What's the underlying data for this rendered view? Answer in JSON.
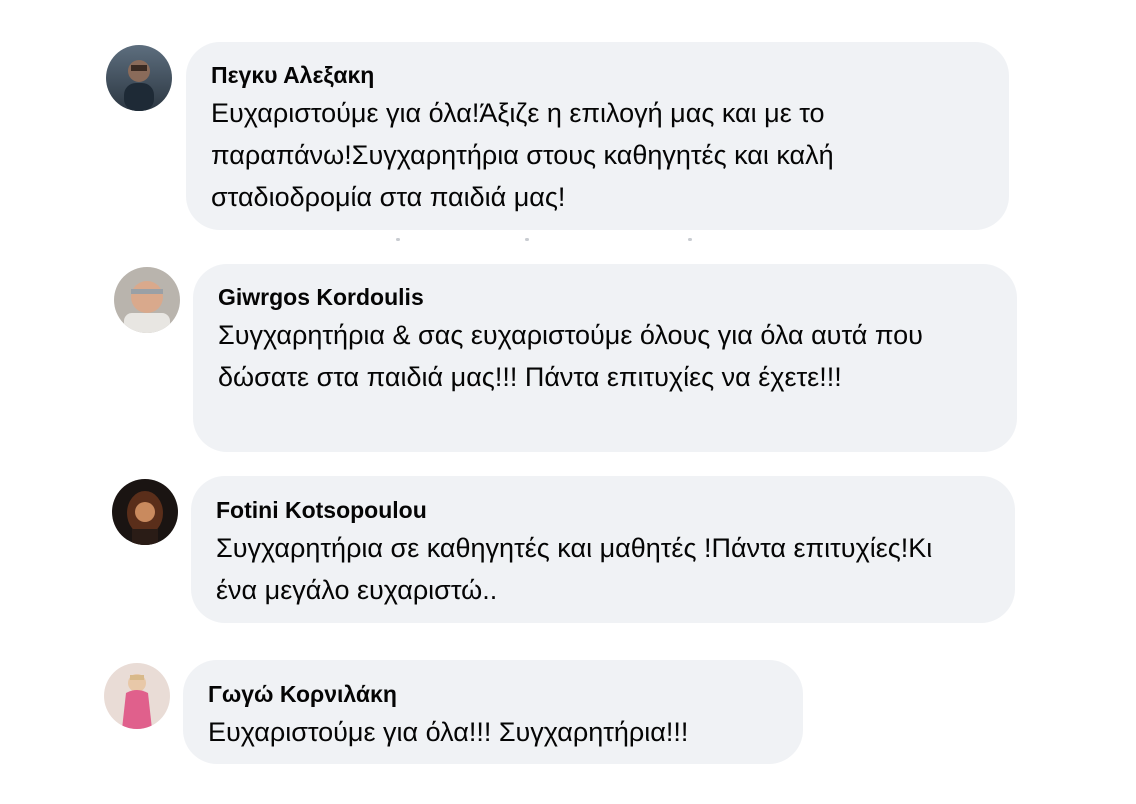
{
  "comments": [
    {
      "author": "Πεγκυ Αλεξακη",
      "text": "Ευχαριστούμε για όλα!Άξιζε η επιλογή μας και με το παραπάνω!Συγχαρητήρια στους καθηγητές και καλή σταδιοδρομία στα παιδιά μας!",
      "avatar": "user-avatar"
    },
    {
      "author": "Giwrgos Kordoulis",
      "text": "Συγχαρητήρια & σας ευχαριστούμε όλους για όλα αυτά που δώσατε στα παιδιά μας!!! Πάντα επιτυχίες να έχετε!!!",
      "avatar": "user-avatar"
    },
    {
      "author": "Fotini Kotsopoulou",
      "text": "Συγχαρητήρια σε καθηγητές και μαθητές !Πάντα επιτυχίες!Κι ένα μεγάλο ευχαριστώ..",
      "avatar": "user-avatar"
    },
    {
      "author": "Γωγώ Κορνιλάκη",
      "text": "Ευχαριστούμε για όλα!!! Συγχαρητήρια!!!",
      "avatar": "user-avatar"
    }
  ],
  "colors": {
    "bubble_background": "#f0f2f5",
    "text": "#050505",
    "page_background": "#ffffff"
  }
}
